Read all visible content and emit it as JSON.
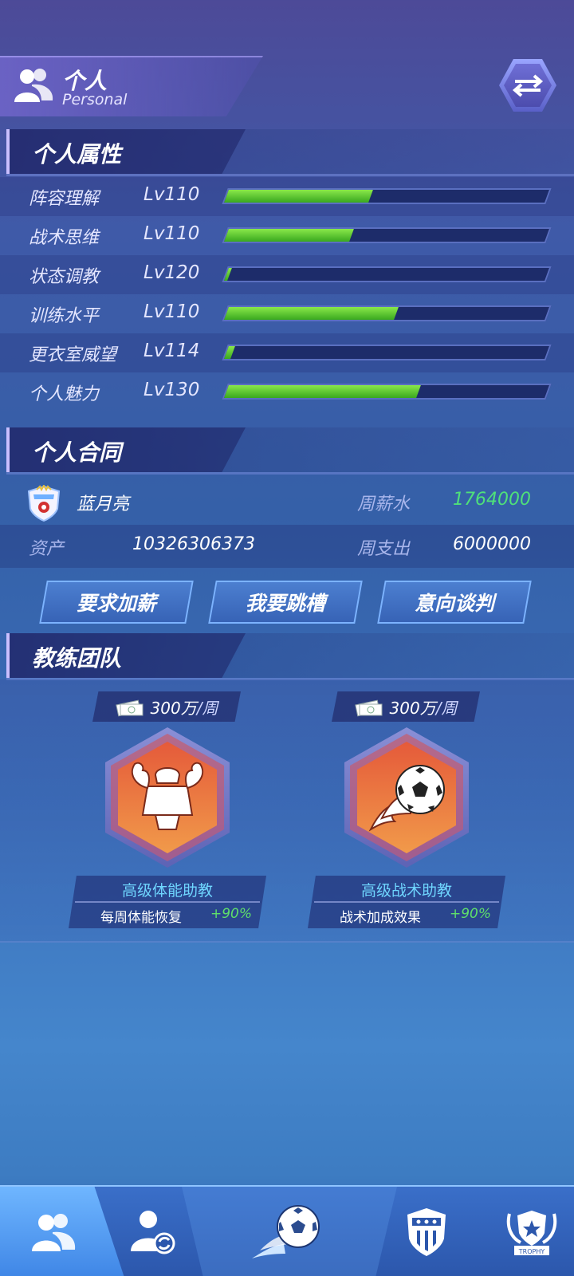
{
  "header": {
    "title": "个人",
    "subtitle": "Personal",
    "icon": "people-icon",
    "switch_icon": "swap-arrows-icon"
  },
  "attributes": {
    "section_title": "个人属性",
    "items": [
      {
        "name": "阵容理解",
        "level": "Lv110",
        "progress": 0.45
      },
      {
        "name": "战术思维",
        "level": "Lv110",
        "progress": 0.39
      },
      {
        "name": "状态调教",
        "level": "Lv120",
        "progress": 0.01
      },
      {
        "name": "训练水平",
        "level": "Lv110",
        "progress": 0.53
      },
      {
        "name": "更衣室威望",
        "level": "Lv114",
        "progress": 0.02
      },
      {
        "name": "个人魅力",
        "level": "Lv130",
        "progress": 0.6
      }
    ]
  },
  "contract": {
    "section_title": "个人合同",
    "club_name": "蓝月亮",
    "weekly_salary_label": "周薪水",
    "weekly_salary_value": "1764000",
    "assets_label": "资产",
    "assets_value": "10326306373",
    "weekly_expense_label": "周支出",
    "weekly_expense_value": "6000000",
    "buttons": [
      "要求加薪",
      "我要跳槽",
      "意向谈判"
    ]
  },
  "coaches": {
    "section_title": "教练团队",
    "items": [
      {
        "price": "300万",
        "unit": "/周",
        "name": "高级体能助教",
        "effect": "每周体能恢复",
        "value": "+90%",
        "icon": "muscle-icon"
      },
      {
        "price": "300万",
        "unit": "/周",
        "name": "高级战术助教",
        "effect": "战术加成效果",
        "value": "+90%",
        "icon": "fire-ball-icon"
      }
    ]
  },
  "nav": {
    "items": [
      "people-icon",
      "player-swap-icon",
      "football-icon",
      "club-shield-icon",
      "trophy-icon"
    ],
    "active": 0,
    "trophy_text": "TROPHY"
  },
  "colors": {
    "progress_fill": "#5fd03a",
    "salary_green": "#4fe07a",
    "coach_name_cyan": "#6fd6ff"
  }
}
